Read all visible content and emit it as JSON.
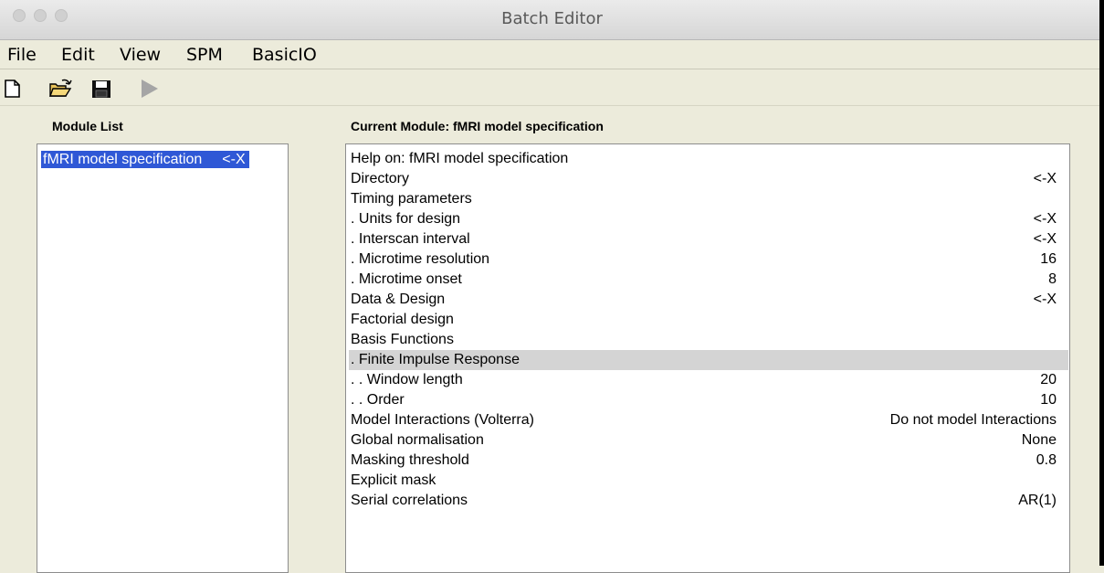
{
  "window": {
    "title": "Batch Editor"
  },
  "menubar": [
    "File",
    "Edit",
    "View",
    "SPM",
    "BasicIO"
  ],
  "toolbar": {
    "new_icon": "new-file-icon",
    "open_icon": "open-folder-icon",
    "save_icon": "save-disk-icon",
    "run_icon": "run-play-icon"
  },
  "module_list": {
    "header": "Module List",
    "items": [
      {
        "label": "fMRI model specification",
        "flag": "<-X"
      }
    ]
  },
  "current_module": {
    "header": "Current Module: fMRI model specification",
    "rows": [
      {
        "label": "Help on: fMRI model specification",
        "value": ""
      },
      {
        "label": "Directory",
        "value": "<-X"
      },
      {
        "label": "Timing parameters",
        "value": ""
      },
      {
        "label": ". Units for design",
        "value": "<-X"
      },
      {
        "label": ". Interscan interval",
        "value": "<-X"
      },
      {
        "label": ". Microtime resolution",
        "value": "16"
      },
      {
        "label": ". Microtime onset",
        "value": "8"
      },
      {
        "label": "Data & Design",
        "value": "<-X"
      },
      {
        "label": "Factorial design",
        "value": ""
      },
      {
        "label": "Basis Functions",
        "value": ""
      },
      {
        "label": ". Finite Impulse Response",
        "value": "",
        "selected": true
      },
      {
        "label": ". . Window length",
        "value": "20"
      },
      {
        "label": ". . Order",
        "value": "10"
      },
      {
        "label": "Model Interactions (Volterra)",
        "value": "Do not model Interactions"
      },
      {
        "label": "Global normalisation",
        "value": "None"
      },
      {
        "label": "Masking threshold",
        "value": "0.8"
      },
      {
        "label": "Explicit mask",
        "value": ""
      },
      {
        "label": "Serial correlations",
        "value": "AR(1)"
      }
    ]
  },
  "colors": {
    "selection": "#2f58d6",
    "row_highlight": "#d4d4d4",
    "background": "#ecebdb"
  }
}
